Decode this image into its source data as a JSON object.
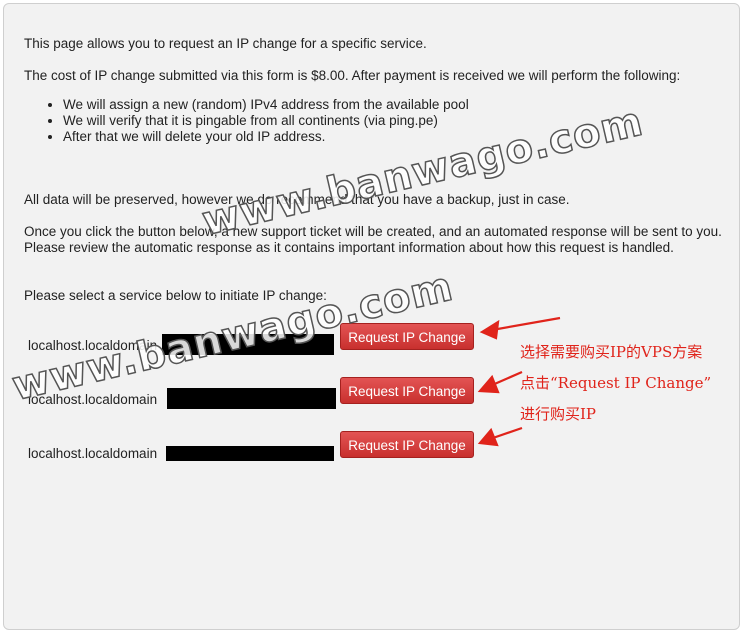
{
  "intro": "This page allows you to request an IP change for a specific service.",
  "cost_text": "The cost of IP change submitted via this form is $8.00. After payment is received we will perform the following:",
  "steps": [
    "We will assign a new (random) IPv4 address from the available pool",
    "We will verify that it is pingable from all continents (via ping.pe)",
    "After that we will delete your old IP address."
  ],
  "preserve_text": "All data will be preserved, however we do recommend that you have a backup, just in case.",
  "ticket_text": "Once you click the button below, a new support ticket will be created, and an automated response will be sent to you. Please review the automatic response as it contains important information about how this request is handled.",
  "select_text": "Please select a service below to initiate IP change:",
  "services": [
    {
      "hostname": "localhost.localdomain",
      "button": "Request IP Change"
    },
    {
      "hostname": "localhost.localdomain",
      "button": "Request IP Change"
    },
    {
      "hostname": "localhost.localdomain",
      "button": "Request IP Change"
    }
  ],
  "annotation": {
    "line1": "选择需要购买IP的VPS方案",
    "line2": "点击“Request IP Change”",
    "line3": "进行购买IP"
  },
  "watermark": "www.banwago.com",
  "colors": {
    "button": "#c8302e",
    "annotation": "#e0241b",
    "panel": "#f2f2f2"
  }
}
